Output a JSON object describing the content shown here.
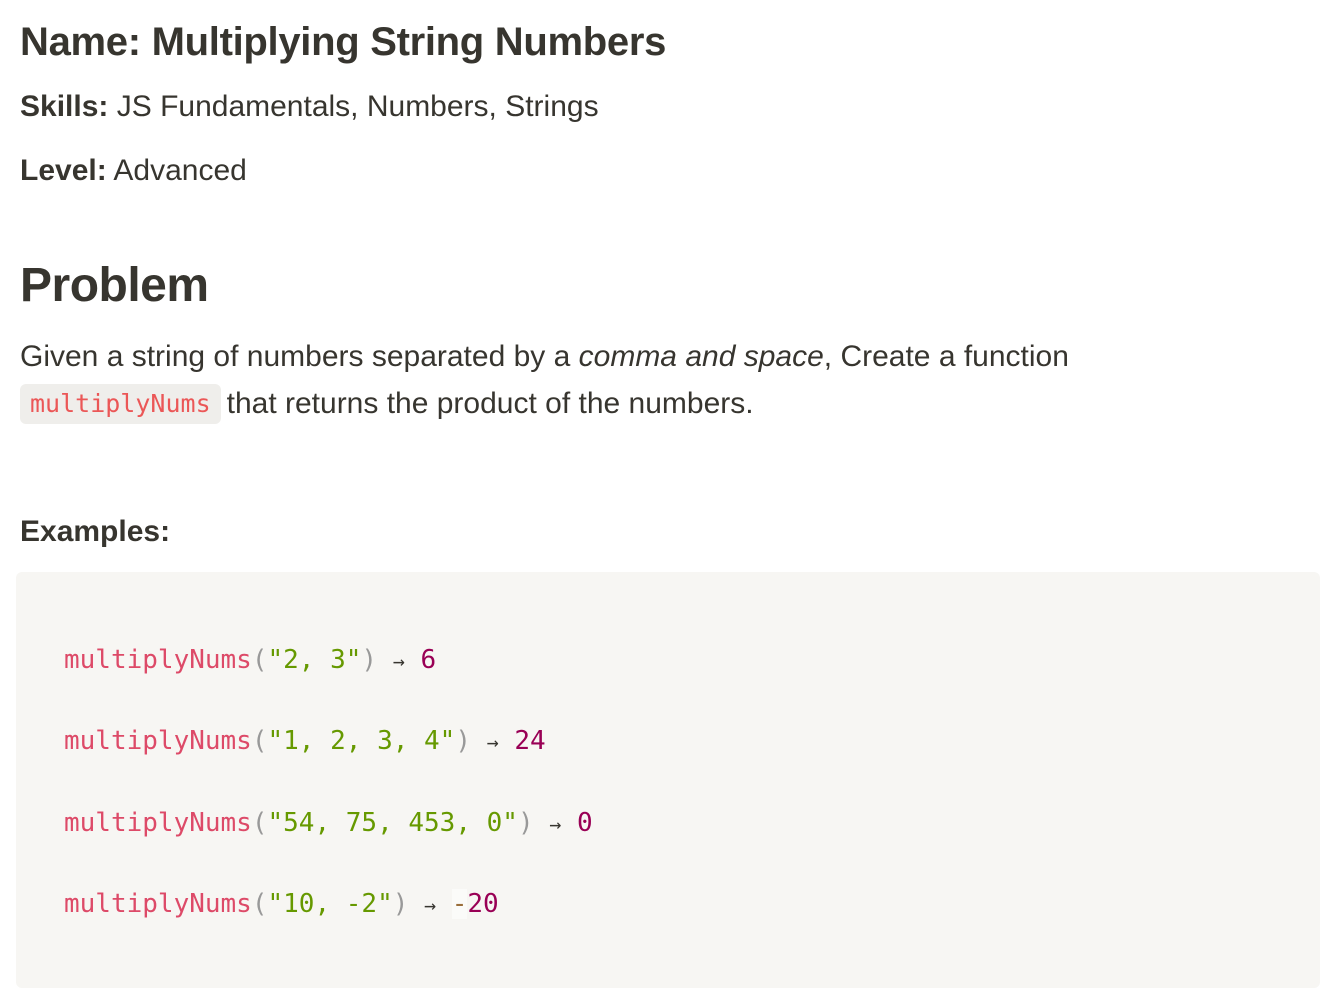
{
  "header": {
    "name_label": "Name:",
    "name_value": "Multiplying String Numbers",
    "skills_label": "Skills:",
    "skills_value": "JS Fundamentals, Numbers, Strings",
    "level_label": "Level:",
    "level_value": "Advanced"
  },
  "problem": {
    "heading": "Problem",
    "desc_part1": "Given a string of numbers separated by a ",
    "desc_emphasis": "comma and space",
    "desc_part2": ", Create a function",
    "inline_code": "multiplyNums",
    "desc_part3": "that returns the product of the numbers."
  },
  "examples": {
    "heading": "Examples:",
    "arrow": "→",
    "lines": [
      {
        "fn": "multiplyNums",
        "open": "(",
        "arg": "\"2, 3\"",
        "close": ")",
        "sign": "",
        "result": "6"
      },
      {
        "fn": "multiplyNums",
        "open": "(",
        "arg": "\"1, 2, 3, 4\"",
        "close": ")",
        "sign": "",
        "result": "24"
      },
      {
        "fn": "multiplyNums",
        "open": "(",
        "arg": "\"54, 75, 453, 0\"",
        "close": ")",
        "sign": "",
        "result": "0"
      },
      {
        "fn": "multiplyNums",
        "open": "(",
        "arg": "\"10, -2\"",
        "close": ")",
        "sign": "-",
        "result": "20"
      }
    ]
  },
  "colors": {
    "text": "#37352f",
    "inline_code_bg": "#efeeeb",
    "inline_code_text": "#eb5757",
    "code_block_bg": "#f7f6f3",
    "token_function": "#dd4a68",
    "token_string": "#669900",
    "token_number": "#990055",
    "token_punctuation": "#999999"
  }
}
